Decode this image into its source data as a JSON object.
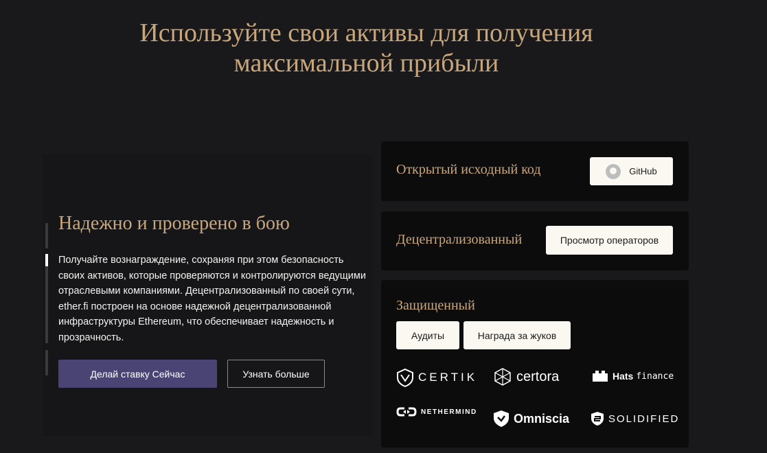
{
  "hero": {
    "title_line1": "Используйте свои активы для получения",
    "title_line2": "максимальной прибыли"
  },
  "left": {
    "title": "Надежно и проверено в бою",
    "description": "Получайте вознаграждение, сохраняя при этом безопасность своих активов, которые проверяются и контролируются ведущими отраслевыми компаниями. Децентрализованный по своей сути, ether.fi построен на основе надежной децентрализованной инфраструктуры Ethereum, что обеспечивает надежность и прозрачность.",
    "primary_button": "Делай ставку Сейчас",
    "secondary_button": "Узнать больше"
  },
  "cards": {
    "open_source": {
      "title": "Открытый исходный код",
      "button": "GitHub",
      "icon": "github-icon"
    },
    "decentralized": {
      "title": "Децентрализованный",
      "button": "Просмотр операторов"
    },
    "secured": {
      "title": "Защищенный",
      "audits_button": "Аудиты",
      "bounty_button": "Награда за жуков",
      "logos": {
        "certik": "CERTIK",
        "certora": "certora",
        "hats_bold": "Hats",
        "hats_rest": "finance",
        "nethermind": "NETHERMIND",
        "omniscia": "Omniscia",
        "solidified": "SOLIDIFIED"
      }
    }
  },
  "colors": {
    "background": "#19191b",
    "accent_gold": "#c9a77c",
    "primary_button": "#4a4475",
    "card_bg": "#0c0c0d",
    "light_button": "#fbf8f1"
  }
}
